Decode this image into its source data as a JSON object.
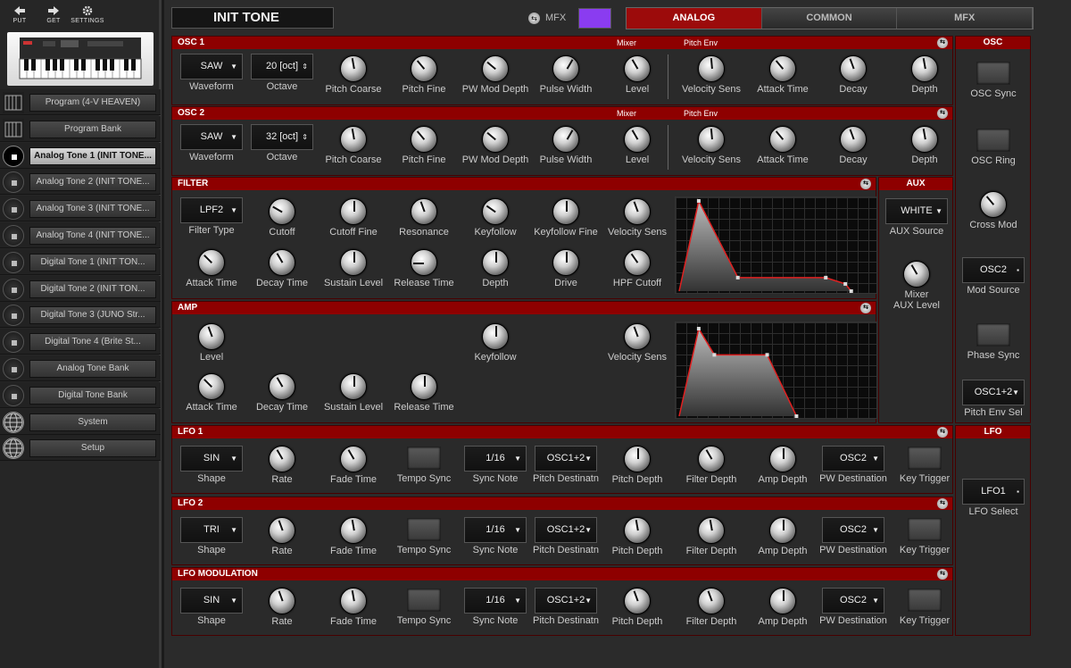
{
  "toolbar": {
    "put": "PUT",
    "get": "GET",
    "settings": "SETTINGS"
  },
  "sidebar": {
    "items": [
      {
        "label": "Program (4-V HEAVEN)",
        "icon": "keyboard-icon"
      },
      {
        "label": "Program Bank",
        "icon": "keyboard-icon"
      },
      {
        "label": "Analog Tone 1 (INIT TONE...",
        "icon": "tone-icon",
        "selected": true
      },
      {
        "label": "Analog Tone 2 (INIT TONE...",
        "icon": "tone-icon"
      },
      {
        "label": "Analog Tone 3 (INIT TONE...",
        "icon": "tone-icon"
      },
      {
        "label": "Analog Tone 4 (INIT TONE...",
        "icon": "tone-icon"
      },
      {
        "label": "Digital Tone 1 (INIT TON...",
        "icon": "tone-icon"
      },
      {
        "label": "Digital Tone 2 (INIT TON...",
        "icon": "tone-icon"
      },
      {
        "label": "Digital Tone 3 (JUNO Str...",
        "icon": "tone-icon"
      },
      {
        "label": "Digital Tone 4 (Brite St...",
        "icon": "tone-icon"
      },
      {
        "label": "Analog Tone Bank",
        "icon": "bank-icon"
      },
      {
        "label": "Digital Tone Bank",
        "icon": "bank-icon"
      },
      {
        "label": "System",
        "icon": "globe-icon"
      },
      {
        "label": "Setup",
        "icon": "globe-icon"
      }
    ]
  },
  "header": {
    "tone_name": "INIT TONE",
    "mfx_label": "MFX",
    "mfx_color": "#8a3cf0",
    "tabs": [
      "ANALOG",
      "COMMON",
      "MFX"
    ],
    "active_tab": "ANALOG"
  },
  "osc1": {
    "title": "OSC 1",
    "mixer": "Mixer",
    "pitch_env": "Pitch Env",
    "waveform": "SAW",
    "octave": "20 [oct]",
    "labels": [
      "Waveform",
      "Octave",
      "Pitch Coarse",
      "Pitch Fine",
      "PW Mod Depth",
      "Pulse Width",
      "Level",
      "Velocity Sens",
      "Attack Time",
      "Decay",
      "Depth"
    ]
  },
  "osc2": {
    "title": "OSC 2",
    "mixer": "Mixer",
    "pitch_env": "Pitch Env",
    "waveform": "SAW",
    "octave": "32 [oct]",
    "labels": [
      "Waveform",
      "Octave",
      "Pitch Coarse",
      "Pitch Fine",
      "PW Mod Depth",
      "Pulse Width",
      "Level",
      "Velocity Sens",
      "Attack Time",
      "Decay",
      "Depth"
    ]
  },
  "filter": {
    "title": "FILTER",
    "type": "LPF2",
    "row1": [
      "Filter Type",
      "Cutoff",
      "Cutoff Fine",
      "Resonance",
      "Keyfollow",
      "Keyfollow Fine",
      "Velocity Sens"
    ],
    "row2": [
      "Attack Time",
      "Decay Time",
      "Sustain Level",
      "Release Time",
      "Depth",
      "Drive",
      "HPF Cutoff"
    ]
  },
  "aux": {
    "title": "AUX",
    "source": "WHITE",
    "source_label": "AUX Source",
    "level_label1": "Mixer",
    "level_label2": "AUX Level"
  },
  "amp": {
    "title": "AMP",
    "row1": [
      "Level",
      "Keyfollow",
      "Velocity Sens"
    ],
    "row2": [
      "Attack Time",
      "Decay Time",
      "Sustain Level",
      "Release Time"
    ]
  },
  "osc_side": {
    "title": "OSC",
    "osc_sync": "OSC Sync",
    "osc_ring": "OSC Ring",
    "cross_mod": "Cross Mod",
    "mod_source": "OSC2",
    "mod_source_label": "Mod Source",
    "phase_sync": "Phase Sync",
    "pitch_env_sel": "OSC1+2",
    "pitch_env_sel_label": "Pitch Env Sel"
  },
  "lfo_side": {
    "title": "LFO",
    "select": "LFO1",
    "select_label": "LFO Select"
  },
  "lfo1": {
    "title": "LFO 1",
    "shape": "SIN",
    "sync_note": "1/16",
    "pitch_dest": "OSC1+2",
    "pw_dest": "OSC2",
    "labels": [
      "Shape",
      "Rate",
      "Fade Time",
      "Tempo Sync",
      "Sync Note",
      "Pitch Destinatn",
      "Pitch Depth",
      "Filter Depth",
      "Amp Depth",
      "PW Destination",
      "Key Trigger"
    ]
  },
  "lfo2": {
    "title": "LFO 2",
    "shape": "TRI",
    "sync_note": "1/16",
    "pitch_dest": "OSC1+2",
    "pw_dest": "OSC2",
    "labels": [
      "Shape",
      "Rate",
      "Fade Time",
      "Tempo Sync",
      "Sync Note",
      "Pitch Destinatn",
      "Pitch Depth",
      "Filter Depth",
      "Amp Depth",
      "PW Destination",
      "Key Trigger"
    ]
  },
  "lfomod": {
    "title": "LFO MODULATION",
    "shape": "SIN",
    "sync_note": "1/16",
    "pitch_dest": "OSC1+2",
    "pw_dest": "OSC2",
    "labels": [
      "Shape",
      "Rate",
      "Fade Time",
      "Tempo Sync",
      "Sync Note",
      "Pitch Destinatn",
      "Pitch Depth",
      "Filter Depth",
      "Amp Depth",
      "PW Destination",
      "Key Trigger"
    ]
  },
  "filter_env": {
    "points": [
      [
        0,
        0
      ],
      [
        0.1,
        1
      ],
      [
        0.3,
        0.15
      ],
      [
        0.75,
        0.15
      ],
      [
        0.85,
        0.08
      ],
      [
        0.88,
        0
      ]
    ]
  },
  "amp_env": {
    "points": [
      [
        0,
        0
      ],
      [
        0.1,
        0.97
      ],
      [
        0.18,
        0.68
      ],
      [
        0.45,
        0.68
      ],
      [
        0.6,
        0
      ]
    ]
  }
}
